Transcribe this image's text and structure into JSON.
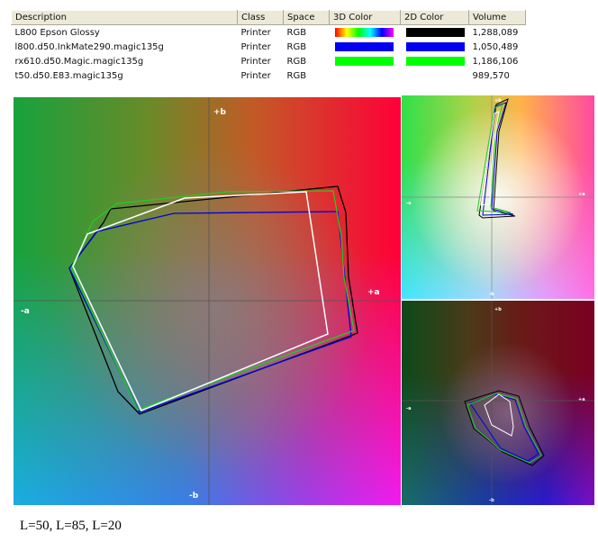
{
  "table": {
    "columns": [
      "Description",
      "Class",
      "Space",
      "3D Color",
      "2D Color",
      "Volume"
    ],
    "rows": [
      {
        "description": "L800 Epson Glossy",
        "class": "Printer",
        "space": "RGB",
        "color3d": "rainbow-gradient",
        "color2d": "#000000",
        "volume": "1,288,089"
      },
      {
        "description": "l800.d50.InkMate290.magic135g",
        "class": "Printer",
        "space": "RGB",
        "color3d": "#0000ee",
        "color2d": "#0000ee",
        "volume": "1,050,489"
      },
      {
        "description": "rx610.d50.Magic.magic135g",
        "class": "Printer",
        "space": "RGB",
        "color3d": "#00ff00",
        "color2d": "#00ff00",
        "volume": "1,186,106"
      },
      {
        "description": "t50.d50.E83.magic135g",
        "class": "Printer",
        "space": "RGB",
        "color3d": "",
        "color2d": "",
        "volume": "989,570"
      }
    ]
  },
  "plots": {
    "main": {
      "axis_pos_b": "+b",
      "axis_neg_b": "-b",
      "axis_pos_a": "+a",
      "axis_neg_a": "-a"
    },
    "top_right": {
      "axis_pos_b": "+b",
      "axis_neg_b": "-b",
      "axis_pos_a": "+a",
      "axis_neg_a": "-a"
    },
    "bottom_right": {
      "axis_pos_b": "+b",
      "axis_neg_b": "-b",
      "axis_pos_a": "+a",
      "axis_neg_a": "-a"
    }
  },
  "caption": "L=50, L=85, L=20"
}
